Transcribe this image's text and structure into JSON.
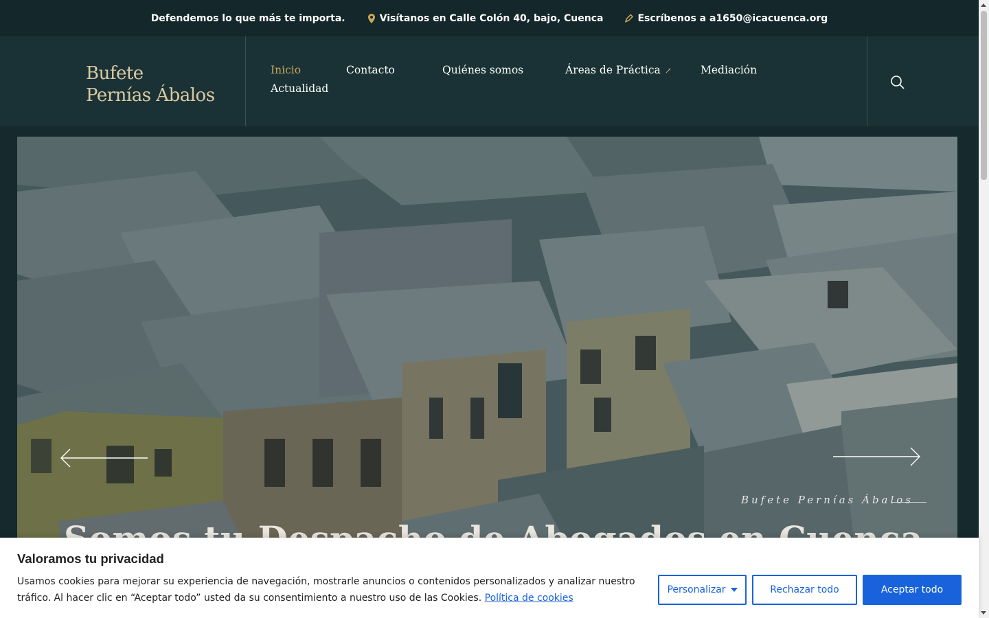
{
  "topbar": {
    "tagline": "Defendemos lo que más te importa.",
    "address": "Visítanos en Calle Colón 40, bajo, Cuenca",
    "email": "Escríbenos a a1650@icacuenca.org"
  },
  "header": {
    "logo_line1": "Bufete",
    "logo_line2": "Pernías Ábalos",
    "nav": {
      "inicio": "Inicio",
      "contacto": "Contacto",
      "quienes": "Quiénes somos",
      "areas": "Áreas de Práctica",
      "mediacion": "Mediación",
      "actualidad": "Actualidad"
    },
    "active_item": "Inicio"
  },
  "hero": {
    "caption": "Bufete Pernías Ábalos",
    "title": "Somos tu Despacho de Abogados en Cuenca"
  },
  "cookie_banner": {
    "title": "Valoramos tu privacidad",
    "text": "Usamos cookies para mejorar su experiencia de navegación, mostrarle anuncios o contenidos personalizados y analizar nuestro tráfico. Al hacer clic en “Aceptar todo” usted da su consentimiento a nuestro uso de las Cookies.",
    "policy_link": "Política de cookies",
    "customize_label": "Personalizar",
    "reject_label": "Rechazar todo",
    "accept_label": "Aceptar todo"
  },
  "colors": {
    "dark_teal": "#14272a",
    "header_bg": "#1a3235",
    "accent_gold": "#c9a75b",
    "cookie_blue": "#1863dc"
  },
  "icons": [
    "location-pin-icon",
    "pen-icon",
    "external-arrow-icon",
    "search-icon",
    "arrow-left-icon",
    "arrow-right-icon",
    "caret-down-icon"
  ]
}
